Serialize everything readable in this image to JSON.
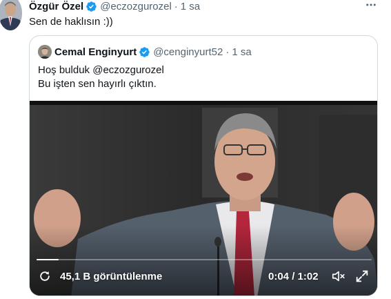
{
  "tweet": {
    "author_name": "Özgür Özel",
    "author_handle": "@eczozgurozel",
    "separator": "·",
    "time": "1 sa",
    "text": "Sen de haklısın :))",
    "verified_icon": "verified-badge-icon",
    "more_icon": "more-horizontal-icon"
  },
  "quote": {
    "author_name": "Cemal Enginyurt",
    "author_handle": "@cenginyurt52",
    "separator": "·",
    "time": "1 sa",
    "text_line1": "Hoş bulduk @eczozgurozel",
    "text_line2": "Bu işten sen hayırlı çıktın."
  },
  "video": {
    "views": "45,1 B görüntülenme",
    "timecode": "0:04 / 1:02",
    "progress": 0.065,
    "views_icon": "replay-icon",
    "volume_icon": "muted-speaker-icon",
    "fullscreen_icon": "fullscreen-icon"
  },
  "colors": {
    "verified": "#1d9bf0",
    "secondary_text": "#536471",
    "primary_text": "#0f1419",
    "border": "#cfd9de"
  }
}
